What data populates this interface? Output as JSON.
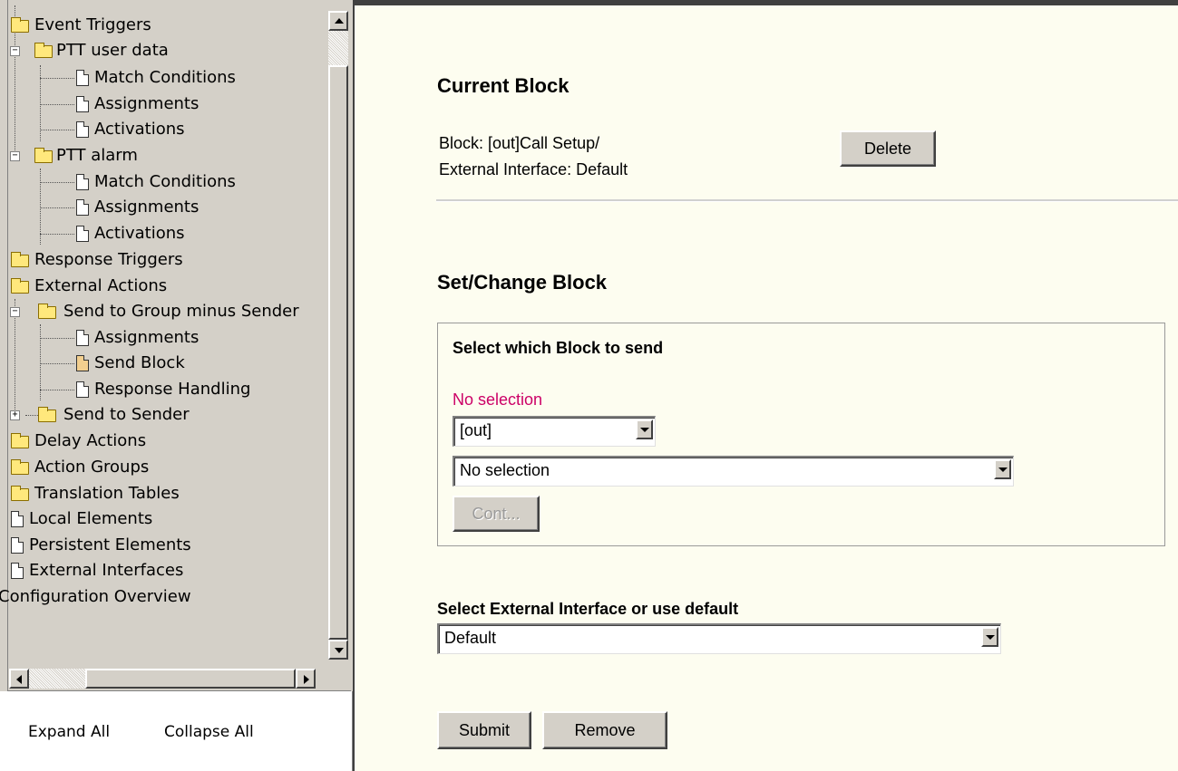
{
  "tree": {
    "items": [
      {
        "label": "Event Triggers",
        "type": "folder"
      },
      {
        "label": "PTT user data",
        "type": "folder"
      },
      {
        "label": "Match Conditions",
        "type": "page"
      },
      {
        "label": "Assignments",
        "type": "page"
      },
      {
        "label": "Activations",
        "type": "page"
      },
      {
        "label": "PTT alarm",
        "type": "folder"
      },
      {
        "label": "Match Conditions",
        "type": "page"
      },
      {
        "label": "Assignments",
        "type": "page"
      },
      {
        "label": "Activations",
        "type": "page"
      },
      {
        "label": "Response Triggers",
        "type": "folder"
      },
      {
        "label": "External Actions",
        "type": "folder"
      },
      {
        "label": "Send to Group minus Sender",
        "type": "folder"
      },
      {
        "label": "Assignments",
        "type": "page"
      },
      {
        "label": "Send Block",
        "type": "page",
        "selected": true
      },
      {
        "label": "Response Handling",
        "type": "page"
      },
      {
        "label": "Send to Sender",
        "type": "folder"
      },
      {
        "label": "Delay Actions",
        "type": "folder"
      },
      {
        "label": "Action Groups",
        "type": "folder"
      },
      {
        "label": "Translation Tables",
        "type": "folder"
      },
      {
        "label": "Local Elements",
        "type": "page"
      },
      {
        "label": "Persistent Elements",
        "type": "page"
      },
      {
        "label": "External Interfaces",
        "type": "page"
      },
      {
        "label": "Configuration Overview",
        "type": "text"
      }
    ],
    "expand_all": "Expand All",
    "collapse_all": "Collapse All"
  },
  "current_block": {
    "heading": "Current Block",
    "block_line": "Block: [out]Call Setup/",
    "interface_line": "External Interface: Default",
    "delete_label": "Delete"
  },
  "set_change": {
    "heading": "Set/Change Block",
    "box_title": "Select which Block to send",
    "status": "No selection",
    "status_color": "#cc0066",
    "direction_value": "[out]",
    "block_value": "No selection",
    "cont_label": "Cont..."
  },
  "interface": {
    "label": "Select External Interface or use default",
    "value": "Default"
  },
  "actions": {
    "submit_label": "Submit",
    "remove_label": "Remove"
  }
}
